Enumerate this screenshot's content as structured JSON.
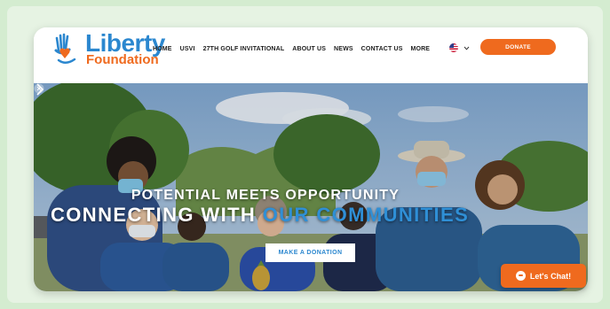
{
  "header": {
    "logo": {
      "title": "Liberty",
      "subtitle": "Foundation"
    },
    "nav": [
      "HOME",
      "USVI",
      "27TH GOLF INVITATIONAL",
      "ABOUT US",
      "NEWS",
      "CONTACT US",
      "MORE"
    ],
    "language_icon": "us-flag-icon",
    "donate_label": "DONATE"
  },
  "hero": {
    "headline_top": "POTENTIAL MEETS OPPORTUNITY",
    "headline_main_white": "CONNECTING WITH ",
    "headline_main_accent": "OUR COMMUNITIES",
    "cta_label": "MAKE A DONATION"
  },
  "chat": {
    "label": "Let's Chat!"
  },
  "colors": {
    "brand_blue": "#2b87cf",
    "brand_orange": "#ef6a1e",
    "page_bg": "#d4ecd0"
  }
}
